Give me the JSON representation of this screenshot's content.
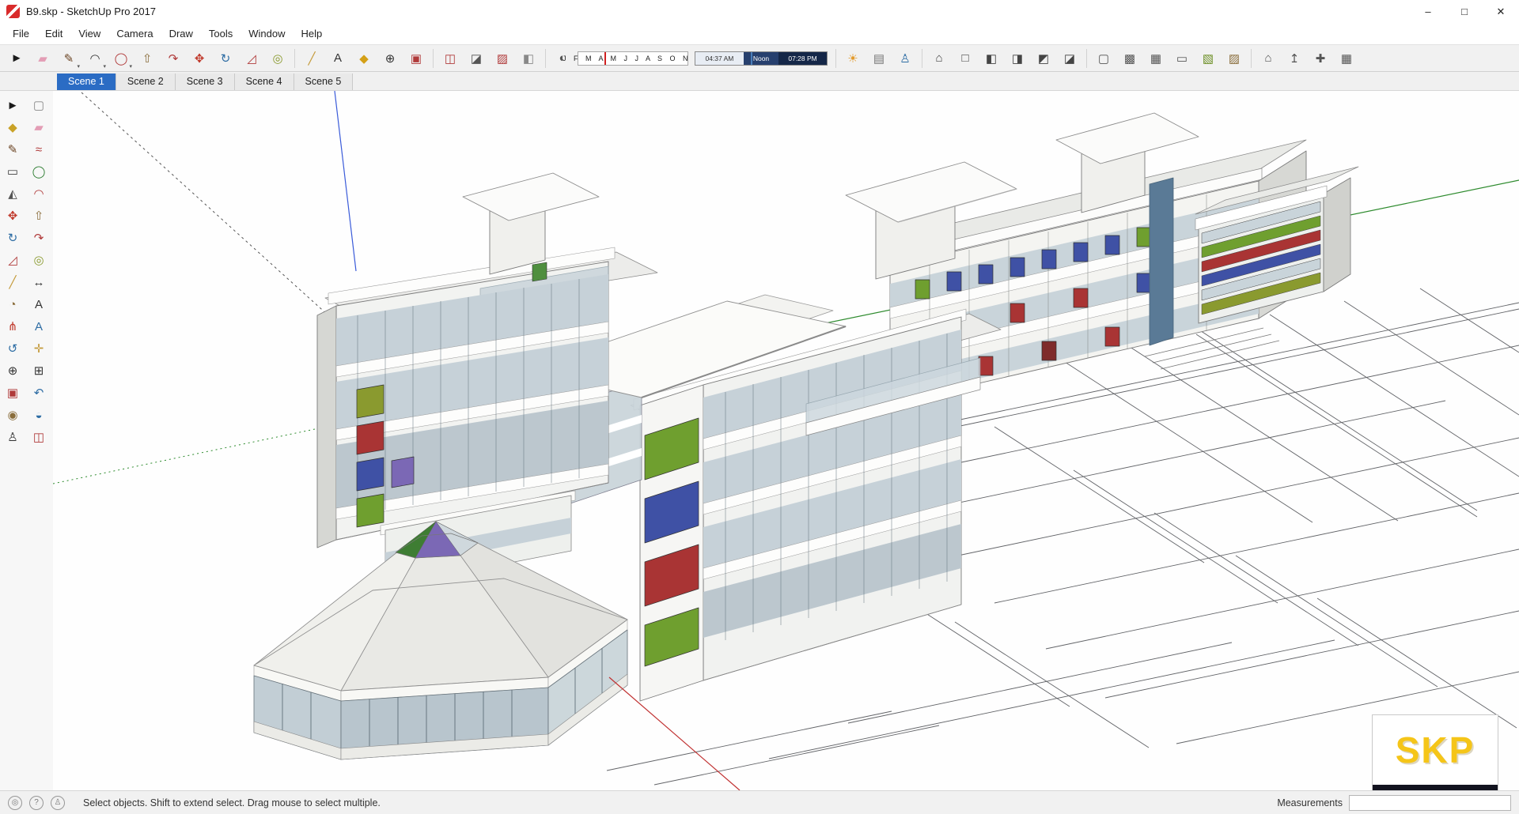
{
  "window": {
    "title": "B9.skp - SketchUp Pro 2017"
  },
  "menu": {
    "items": [
      "File",
      "Edit",
      "View",
      "Camera",
      "Draw",
      "Tools",
      "Window",
      "Help"
    ]
  },
  "toolbar": {
    "months": "J F M A M J J A S O N D",
    "time_start": "04:37 AM",
    "time_noon": "Noon",
    "time_end": "07:28 PM",
    "groups": {
      "draw": [
        {
          "name": "select",
          "glyph": "►",
          "color": "#1a1a1a"
        },
        {
          "name": "eraser",
          "glyph": "▰",
          "color": "#e39db5"
        },
        {
          "name": "line",
          "glyph": "✎",
          "color": "#6b4423",
          "dd": true
        },
        {
          "name": "arc",
          "glyph": "◠",
          "color": "#333333",
          "dd": true
        },
        {
          "name": "circle",
          "glyph": "◯",
          "color": "#b03a3a",
          "dd": true
        },
        {
          "name": "push-pull",
          "glyph": "⇧",
          "color": "#8a6d3b"
        },
        {
          "name": "follow-me",
          "glyph": "↷",
          "color": "#b03a3a"
        },
        {
          "name": "move",
          "glyph": "✥",
          "color": "#c0392b"
        },
        {
          "name": "rotate",
          "glyph": "↻",
          "color": "#2e6da4"
        },
        {
          "name": "scale",
          "glyph": "◿",
          "color": "#b03a3a"
        },
        {
          "name": "offset",
          "glyph": "◎",
          "color": "#8a9a2f"
        }
      ],
      "measure": [
        {
          "name": "tape-measure",
          "glyph": "╱",
          "color": "#c49a3a"
        },
        {
          "name": "text",
          "glyph": "A",
          "color": "#333333"
        },
        {
          "name": "paint-bucket",
          "glyph": "◆",
          "color": "#d4a017"
        },
        {
          "name": "zoom",
          "glyph": "⊕",
          "color": "#333333"
        },
        {
          "name": "zoom-extents",
          "glyph": "▣",
          "color": "#b03a3a"
        }
      ],
      "section": [
        {
          "name": "section-plane",
          "glyph": "◫",
          "color": "#b03a3a"
        },
        {
          "name": "section-cuts",
          "glyph": "◪",
          "color": "#555555"
        },
        {
          "name": "section-fill",
          "glyph": "▨",
          "color": "#b03a3a"
        },
        {
          "name": "section-display",
          "glyph": "◧",
          "color": "#888888"
        }
      ],
      "shadows": [
        {
          "name": "shadows-toggle",
          "glyph": "◐",
          "color": "#555555"
        }
      ],
      "camera": [
        {
          "name": "shadow-settings",
          "glyph": "☀",
          "color": "#e39b2d"
        },
        {
          "name": "match-photo",
          "glyph": "▤",
          "color": "#777777"
        },
        {
          "name": "walk-tool",
          "glyph": "♙",
          "color": "#2e6da4"
        }
      ],
      "views": [
        {
          "name": "iso-view",
          "glyph": "⌂",
          "color": "#444444"
        },
        {
          "name": "top-view",
          "glyph": "□",
          "color": "#444444"
        },
        {
          "name": "front-view",
          "glyph": "◧",
          "color": "#444444"
        },
        {
          "name": "right-view",
          "glyph": "◨",
          "color": "#444444"
        },
        {
          "name": "back-view",
          "glyph": "◩",
          "color": "#444444"
        },
        {
          "name": "left-view",
          "glyph": "◪",
          "color": "#444444"
        }
      ],
      "styles": [
        {
          "name": "xray-style",
          "glyph": "▢",
          "color": "#555555"
        },
        {
          "name": "back-edges-style",
          "glyph": "▩",
          "color": "#555555"
        },
        {
          "name": "wireframe-style",
          "glyph": "▦",
          "color": "#555555"
        },
        {
          "name": "hidden-line-style",
          "glyph": "▭",
          "color": "#555555"
        },
        {
          "name": "shaded-style",
          "glyph": "▧",
          "color": "#6b8e23"
        },
        {
          "name": "shaded-textures-style",
          "glyph": "▨",
          "color": "#8a6d3b"
        }
      ],
      "warehouse": [
        {
          "name": "3d-warehouse",
          "glyph": "⌂",
          "color": "#555555"
        },
        {
          "name": "share-model",
          "glyph": "↥",
          "color": "#555555"
        },
        {
          "name": "extension-warehouse",
          "glyph": "✚",
          "color": "#555555"
        },
        {
          "name": "model-info",
          "glyph": "▦",
          "color": "#555555"
        }
      ]
    }
  },
  "scenes": {
    "tabs": [
      "Scene 1",
      "Scene 2",
      "Scene 3",
      "Scene 4",
      "Scene 5"
    ],
    "active_index": 0
  },
  "palette": {
    "tools": [
      {
        "name": "select",
        "glyph": "►",
        "color": "#1a1a1a"
      },
      {
        "name": "make-component",
        "glyph": "▢",
        "color": "#888888"
      },
      {
        "name": "paint-bucket",
        "glyph": "◆",
        "color": "#c9a227"
      },
      {
        "name": "eraser",
        "glyph": "▰",
        "color": "#e39db5"
      },
      {
        "name": "line",
        "glyph": "✎",
        "color": "#6b4423"
      },
      {
        "name": "freehand",
        "glyph": "≈",
        "color": "#b03a3a"
      },
      {
        "name": "rectangle",
        "glyph": "▭",
        "color": "#3f3f3f"
      },
      {
        "name": "circle",
        "glyph": "◯",
        "color": "#2e7d32"
      },
      {
        "name": "polygon",
        "glyph": "◭",
        "color": "#555555"
      },
      {
        "name": "arc",
        "glyph": "◠",
        "color": "#b03a3a"
      },
      {
        "name": "move",
        "glyph": "✥",
        "color": "#c0392b"
      },
      {
        "name": "push-pull",
        "glyph": "⇧",
        "color": "#8a6d3b"
      },
      {
        "name": "rotate",
        "glyph": "↻",
        "color": "#2e6da4"
      },
      {
        "name": "follow-me",
        "glyph": "↷",
        "color": "#b03a3a"
      },
      {
        "name": "scale",
        "glyph": "◿",
        "color": "#b03a3a"
      },
      {
        "name": "offset",
        "glyph": "◎",
        "color": "#8a9a2f"
      },
      {
        "name": "tape-measure",
        "glyph": "╱",
        "color": "#c49a3a"
      },
      {
        "name": "dimension",
        "glyph": "↔",
        "color": "#333333"
      },
      {
        "name": "protractor",
        "glyph": "◔",
        "color": "#8a6d3b"
      },
      {
        "name": "text",
        "glyph": "A",
        "color": "#333333"
      },
      {
        "name": "axes",
        "glyph": "⋔",
        "color": "#c0392b"
      },
      {
        "name": "3d-text",
        "glyph": "A",
        "color": "#2e6da4"
      },
      {
        "name": "orbit",
        "glyph": "↺",
        "color": "#2e6da4"
      },
      {
        "name": "pan",
        "glyph": "✛",
        "color": "#c49a3a"
      },
      {
        "name": "zoom",
        "glyph": "⊕",
        "color": "#333333"
      },
      {
        "name": "zoom-window",
        "glyph": "⊞",
        "color": "#333333"
      },
      {
        "name": "zoom-extents",
        "glyph": "▣",
        "color": "#b03a3a"
      },
      {
        "name": "previous-view",
        "glyph": "↶",
        "color": "#2e6da4"
      },
      {
        "name": "position-camera",
        "glyph": "◉",
        "color": "#8a6d3b"
      },
      {
        "name": "look-around",
        "glyph": "◒",
        "color": "#2e6da4"
      },
      {
        "name": "walk",
        "glyph": "♙",
        "color": "#333333"
      },
      {
        "name": "section-plane",
        "glyph": "◫",
        "color": "#b03a3a"
      }
    ]
  },
  "colors": {
    "scene_tab_active": "#2b6cc4",
    "panel_green": "#6f9f2f",
    "panel_olive": "#8a9a2f",
    "panel_red": "#a93434",
    "panel_blue": "#3f51a5",
    "panel_purple": "#7b68b5",
    "glass": "#c6d1d8",
    "axis_red": "#c03030",
    "axis_green": "#2e8b2e",
    "axis_blue": "#3a5bd9",
    "watermark_gold": "#f5c518"
  },
  "statusbar": {
    "message": "Select objects. Shift to extend select. Drag mouse to select multiple.",
    "measurements_label": "Measurements",
    "measurements_value": ""
  },
  "watermark": {
    "text": "SKP"
  }
}
